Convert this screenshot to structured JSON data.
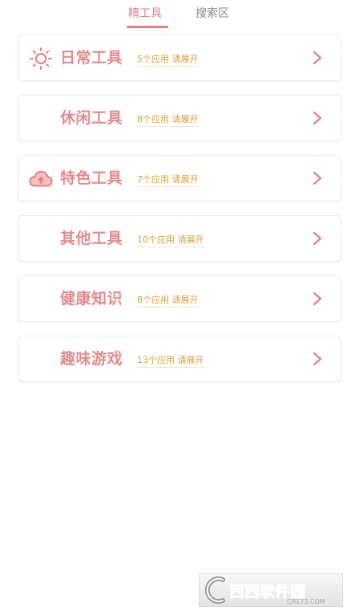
{
  "tabs": {
    "active": "精工具",
    "inactive": "搜索区"
  },
  "categories": [
    {
      "title": "日常工具",
      "meta": "5个应用 请展开",
      "icon": "sun-icon"
    },
    {
      "title": "休闲工具",
      "meta": "8个应用 请展开",
      "icon": ""
    },
    {
      "title": "特色工具",
      "meta": "7个应用 请展开",
      "icon": "cloud-upload-icon"
    },
    {
      "title": "其他工具",
      "meta": "10个应用 请展开",
      "icon": ""
    },
    {
      "title": "健康知识",
      "meta": "8个应用 请展开",
      "icon": ""
    },
    {
      "title": "趣味游戏",
      "meta": "13个应用 请展开",
      "icon": ""
    }
  ],
  "watermark": {
    "brand": "西西软件园",
    "site": "CR173.COM"
  },
  "colors": {
    "accent": "#e57f82",
    "title": "#e48c8e",
    "meta": "#d4a43a",
    "inactive_tab": "#8a8a8a",
    "border": "#ececec"
  }
}
